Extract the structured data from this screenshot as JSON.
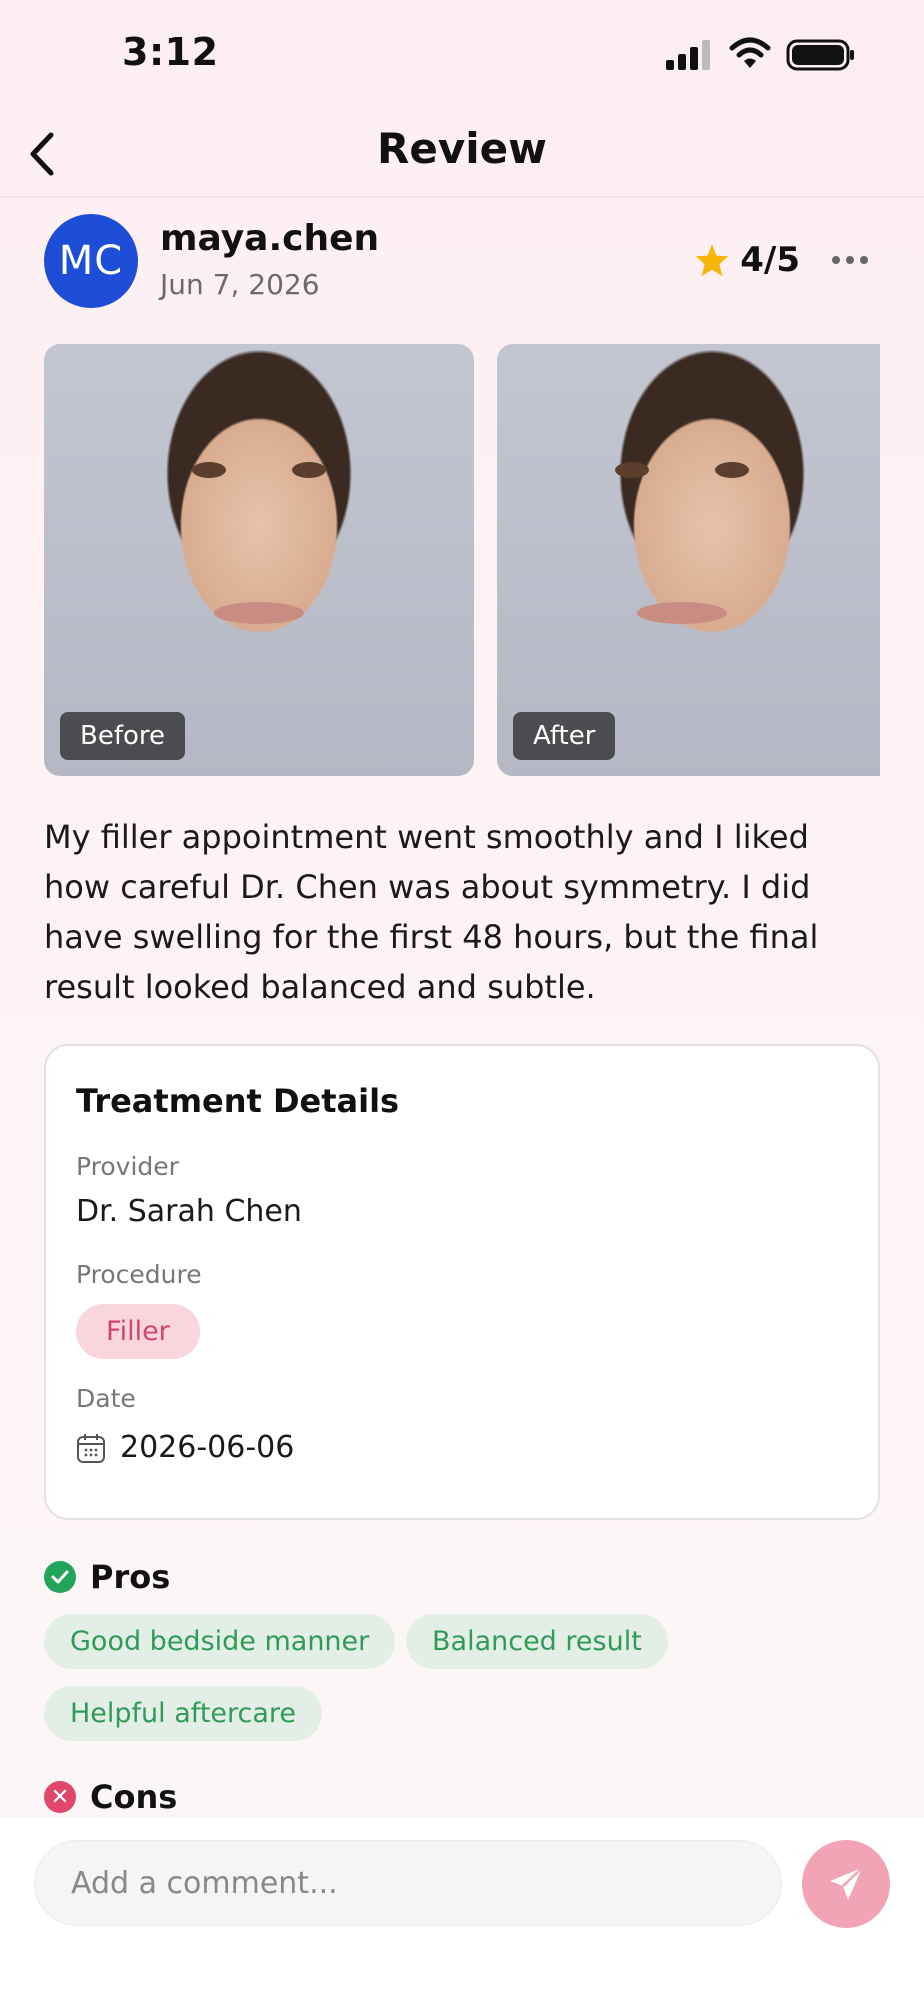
{
  "status_bar": {
    "time": "3:12"
  },
  "nav": {
    "title": "Review"
  },
  "author": {
    "initials": "MC",
    "username": "maya.chen",
    "date": "Jun 7, 2026",
    "rating": "4/5"
  },
  "photos": {
    "before_label": "Before",
    "after_label": "After"
  },
  "review_text": "My filler appointment went smoothly and I liked how careful Dr. Chen was about symmetry. I did have swelling for the first 48 hours, but the final result looked balanced and subtle.",
  "treatment": {
    "title": "Treatment Details",
    "provider_label": "Provider",
    "provider": "Dr. Sarah Chen",
    "procedure_label": "Procedure",
    "procedure": "Filler",
    "date_label": "Date",
    "date": "2026-06-06"
  },
  "pros": {
    "title": "Pros",
    "items": [
      "Good bedside manner",
      "Balanced result",
      "Helpful aftercare"
    ]
  },
  "cons": {
    "title": "Cons"
  },
  "comment": {
    "placeholder": "Add a comment..."
  },
  "colors": {
    "avatar": "#1e4ed8",
    "accent": "#f1a4b6",
    "procedure_tag": "#f9d6de",
    "pro_chip": "#e3efe6",
    "star": "#f5b50a"
  }
}
